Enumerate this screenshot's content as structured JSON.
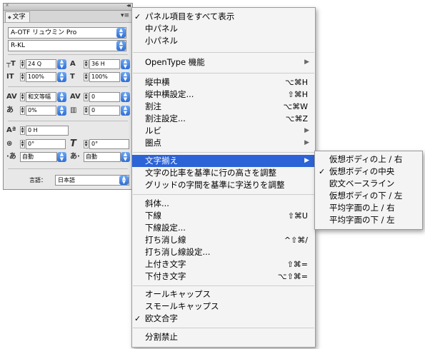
{
  "panel": {
    "tab_label": "文字",
    "font_family": "A-OTF リュウミン Pro",
    "font_style": "R-KL",
    "font_size": "24 Q",
    "leading": "36 H",
    "vertical_scale": "100%",
    "horizontal_scale": "100%",
    "mojikumi": "和文等幅",
    "tracking": "0",
    "tsume": "0%",
    "kerning_value": "0",
    "baseline_shift": "0 H",
    "rotation": "0°",
    "skew": "0°",
    "aki_before": "自動",
    "aki_after": "自動",
    "language_label": "言語：",
    "language": "日本語"
  },
  "menu": {
    "items": [
      {
        "label": "パネル項目をすべて表示",
        "checked": true
      },
      {
        "label": "中パネル"
      },
      {
        "label": "小パネル"
      },
      {
        "label": "OpenType 機能",
        "submenu": true
      },
      {
        "label": "縦中横",
        "shortcut": "⌥⌘H"
      },
      {
        "label": "縦中横設定...",
        "shortcut": "⇧⌘H"
      },
      {
        "label": "割注",
        "shortcut": "⌥⌘W"
      },
      {
        "label": "割注設定...",
        "shortcut": "⌥⌘Z"
      },
      {
        "label": "ルビ",
        "submenu": true
      },
      {
        "label": "圏点",
        "submenu": true
      },
      {
        "label": "文字揃え",
        "submenu": true,
        "highlighted": true
      },
      {
        "label": "文字の比率を基準に行の高さを調整"
      },
      {
        "label": "グリッドの字間を基準に字送りを調整"
      },
      {
        "label": "斜体..."
      },
      {
        "label": "下線",
        "shortcut": "⇧⌘U"
      },
      {
        "label": "下線設定..."
      },
      {
        "label": "打ち消し線",
        "shortcut": "^⇧⌘/"
      },
      {
        "label": "打ち消し線設定..."
      },
      {
        "label": "上付き文字",
        "shortcut": "⇧⌘="
      },
      {
        "label": "下付き文字",
        "shortcut": "⌥⇧⌘="
      },
      {
        "label": "オールキャップス"
      },
      {
        "label": "スモールキャップス"
      },
      {
        "label": "欧文合字",
        "checked": true
      },
      {
        "label": "分割禁止"
      }
    ]
  },
  "submenu": {
    "items": [
      {
        "label": "仮想ボディの上 / 右"
      },
      {
        "label": "仮想ボディの中央",
        "checked": true
      },
      {
        "label": "欧文ベースライン"
      },
      {
        "label": "仮想ボディの下 / 左"
      },
      {
        "label": "平均字面の上 / 右"
      },
      {
        "label": "平均字面の下 / 左"
      }
    ]
  },
  "glyphs": {
    "check": "✓",
    "arrow_right": "▶",
    "updown_top": "▲",
    "updown_bottom": "▼",
    "collapse": "◂◂",
    "close": "x",
    "menu": "▾≡"
  },
  "colors": {
    "highlight": "#2c63d6",
    "dropdown_blue": "#2f6fd6"
  }
}
